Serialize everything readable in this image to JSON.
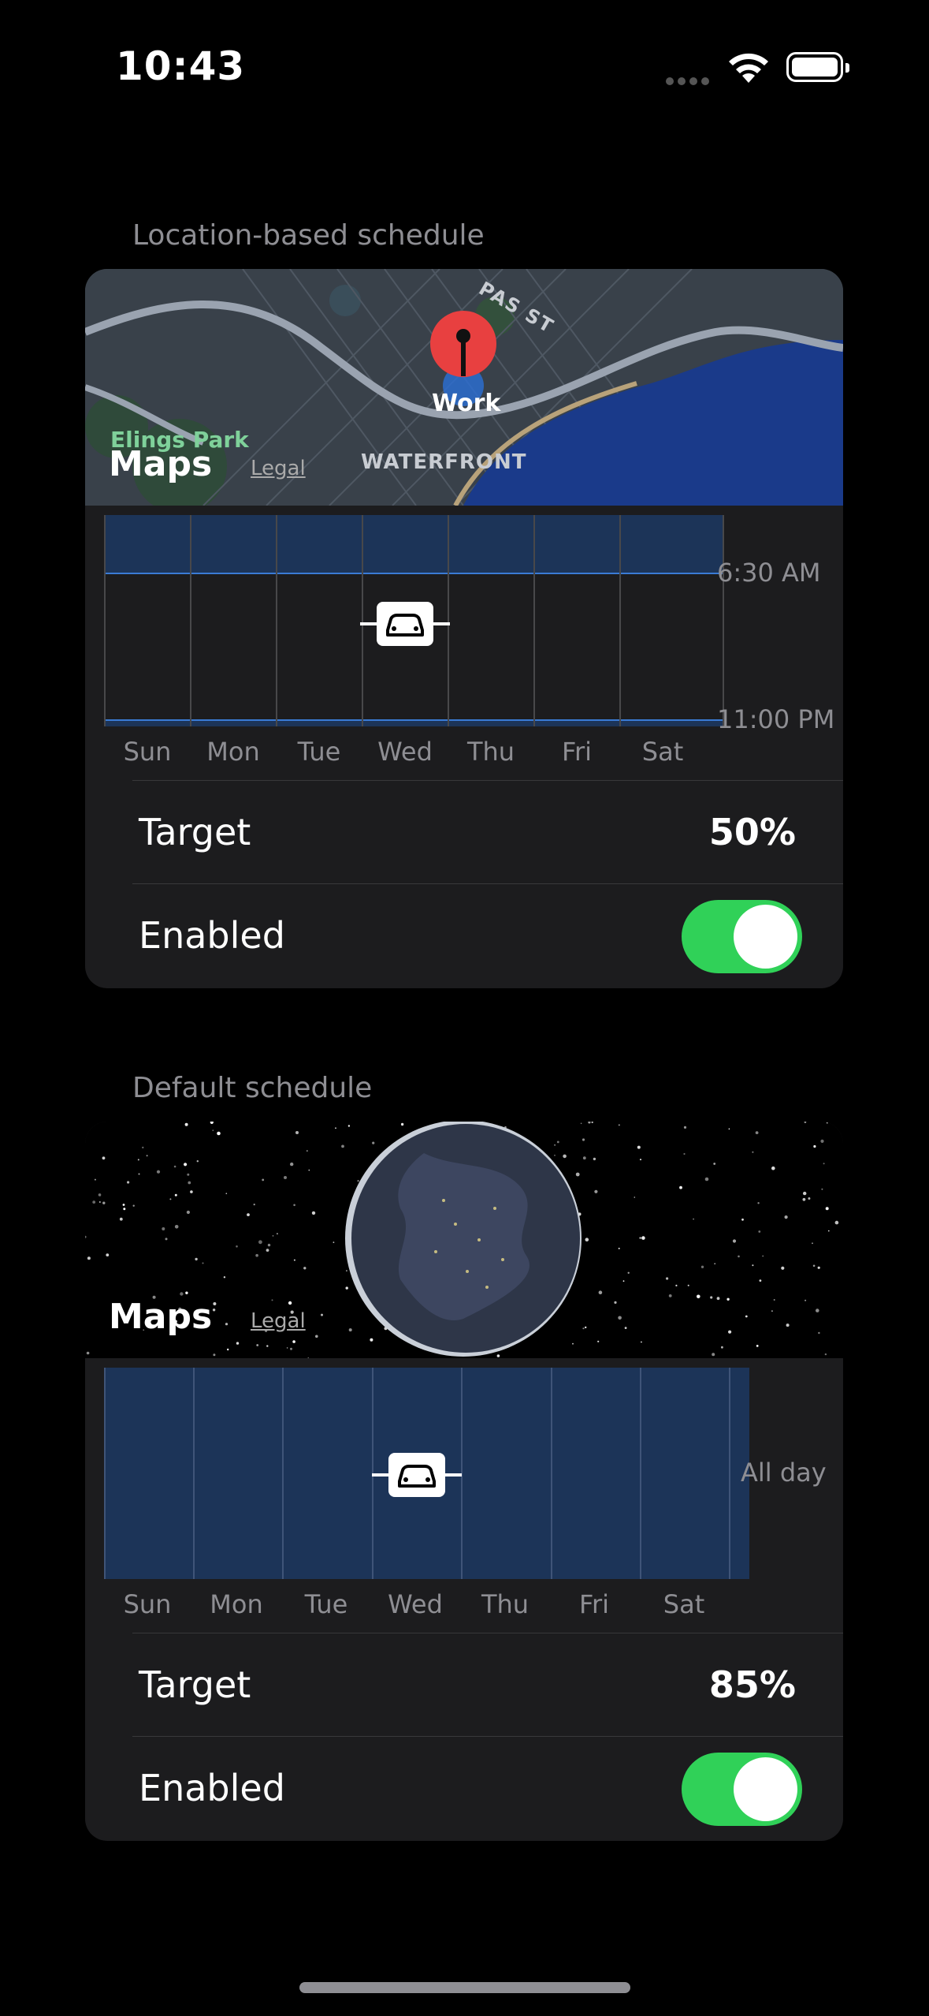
{
  "status_bar": {
    "time": "10:43"
  },
  "location_schedule": {
    "section_label": "Location-based schedule",
    "map": {
      "pin_label": "Work",
      "places": {
        "park": "Elings Park",
        "district": "WATERFRONT",
        "street": "PAS ST"
      },
      "maps_brand": "Maps",
      "legal": "Legal"
    },
    "chart": {
      "days": [
        "Sun",
        "Mon",
        "Tue",
        "Wed",
        "Thu",
        "Fri",
        "Sat"
      ],
      "start_time": "6:30 AM",
      "end_time": "11:00 PM"
    },
    "target_label": "Target",
    "target_value": "50%",
    "enabled_label": "Enabled",
    "enabled": true
  },
  "default_schedule": {
    "section_label": "Default schedule",
    "map": {
      "maps_brand": "Maps",
      "legal": "Legal"
    },
    "chart": {
      "days": [
        "Sun",
        "Mon",
        "Tue",
        "Wed",
        "Thu",
        "Fri",
        "Sat"
      ],
      "time_label": "All day"
    },
    "target_label": "Target",
    "target_value": "85%",
    "enabled_label": "Enabled",
    "enabled": true
  },
  "colors": {
    "accent_green": "#30d158",
    "schedule_blue": "#1c3458",
    "card_bg": "#1c1c1e"
  }
}
